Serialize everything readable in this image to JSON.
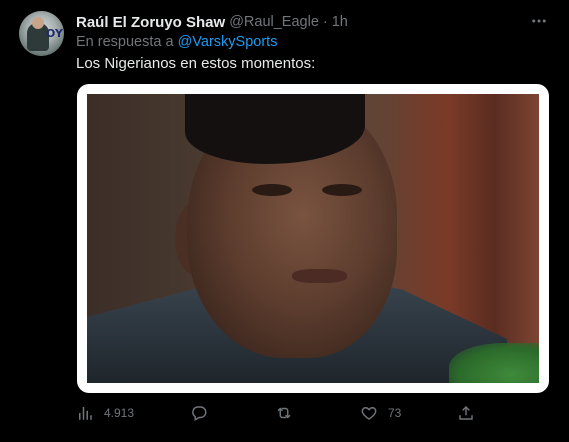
{
  "tweet": {
    "author_name": "Raúl El Zoruyo Shaw",
    "handle": "@Raul_Eagle",
    "separator": "·",
    "time": "1h",
    "reply_prefix": "En respuesta a",
    "reply_to": "@VarskySports",
    "text": "Los Nigerianos en estos momentos:",
    "avatar_text": "OY"
  },
  "actions": {
    "views": "4.913",
    "replies": "",
    "retweets": "",
    "likes": "73"
  },
  "icons": {
    "more": "more-icon",
    "views": "analytics-icon",
    "reply": "reply-icon",
    "retweet": "retweet-icon",
    "like": "heart-icon",
    "share": "share-icon"
  },
  "colors": {
    "background": "#000000",
    "text": "#e7e9ea",
    "muted": "#71767b",
    "link": "#1d9bf0"
  }
}
